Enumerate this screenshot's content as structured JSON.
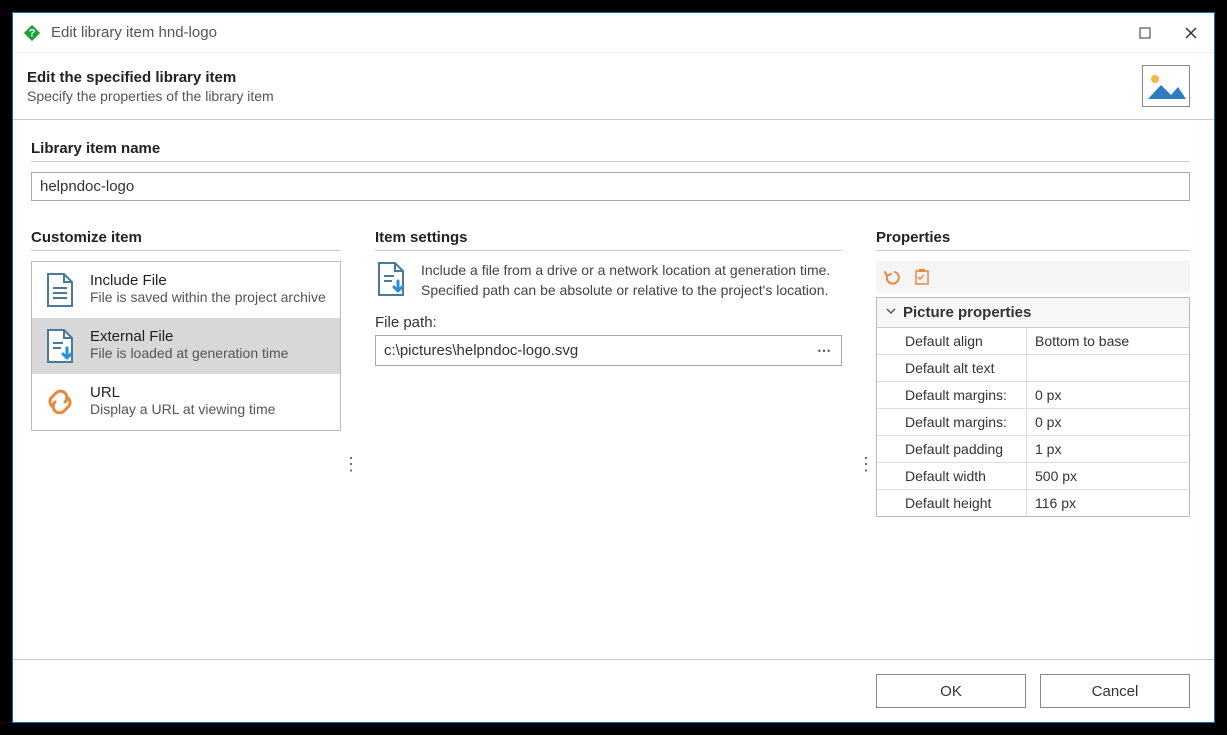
{
  "title": "Edit library item hnd-logo",
  "header": {
    "title": "Edit the specified library item",
    "subtitle": "Specify the properties of the library item"
  },
  "name_section": {
    "label": "Library item name",
    "value": "helpndoc-logo"
  },
  "customize": {
    "label": "Customize item",
    "items": [
      {
        "title": "Include File",
        "desc": "File is saved within the project archive",
        "icon": "file"
      },
      {
        "title": "External File",
        "desc": "File is loaded at generation time",
        "icon": "file-arrow",
        "selected": true
      },
      {
        "title": "URL",
        "desc": "Display a URL at viewing time",
        "icon": "link"
      }
    ]
  },
  "settings": {
    "label": "Item settings",
    "description": "Include a file from a drive or a network location at generation time. Specified path can be absolute or relative to the project's location.",
    "filepath_label": "File path:",
    "filepath_value": "c:\\pictures\\helpndoc-logo.svg"
  },
  "properties": {
    "label": "Properties",
    "group": "Picture properties",
    "rows": [
      {
        "key": "Default align",
        "val": "Bottom to base"
      },
      {
        "key": "Default alt text",
        "val": ""
      },
      {
        "key": "Default margins:",
        "val": "0 px"
      },
      {
        "key": "Default margins:",
        "val": "0 px"
      },
      {
        "key": "Default padding",
        "val": "1 px"
      },
      {
        "key": "Default width",
        "val": "500 px"
      },
      {
        "key": "Default height",
        "val": "116 px"
      }
    ]
  },
  "buttons": {
    "ok": "OK",
    "cancel": "Cancel"
  }
}
